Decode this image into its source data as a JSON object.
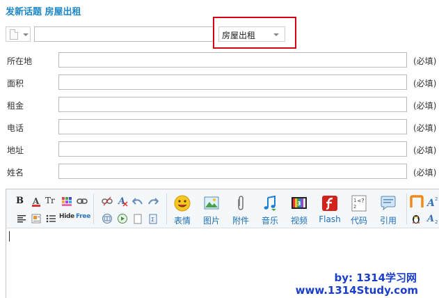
{
  "header": {
    "title": "发新话题 房屋出租"
  },
  "topic": {
    "subject_value": "",
    "category_selected": "房屋出租"
  },
  "fields": [
    {
      "label": "所在地",
      "value": "",
      "required": "(必填)"
    },
    {
      "label": "面积",
      "value": "",
      "required": "(必填)"
    },
    {
      "label": "租金",
      "value": "",
      "required": "(必填)"
    },
    {
      "label": "电话",
      "value": "",
      "required": "(必填)"
    },
    {
      "label": "地址",
      "value": "",
      "required": "(必填)"
    },
    {
      "label": "姓名",
      "value": "",
      "required": "(必填)"
    }
  ],
  "toolbar": {
    "bold": "B",
    "typeface": "Tr",
    "hide": "Hide",
    "free": "Free",
    "emoticon": "表情",
    "image": "图片",
    "attachment": "附件",
    "music": "音乐",
    "video": "视频",
    "flash": "Flash",
    "code": "代码",
    "quote": "引用"
  },
  "watermark": {
    "line1": "by: 1314学习网",
    "line2": "www.1314Study.com"
  },
  "colors": {
    "accent": "#1d87c7",
    "highlight": "#d9000f",
    "link": "#1d6fb8",
    "watermark": "#1b3ec9"
  }
}
